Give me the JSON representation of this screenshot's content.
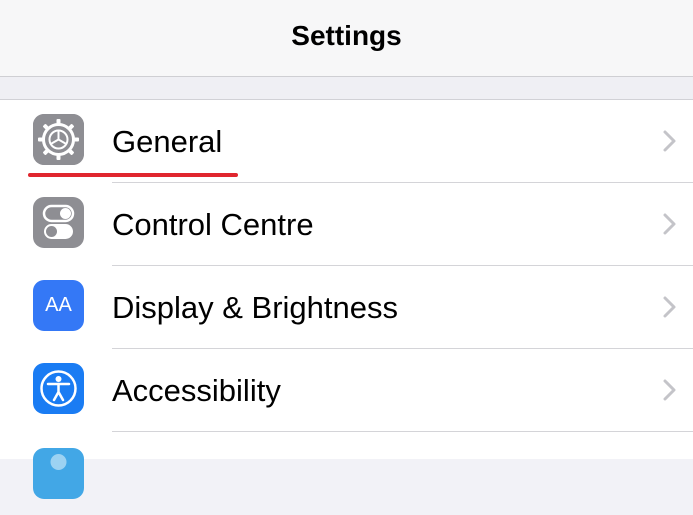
{
  "nav": {
    "title": "Settings"
  },
  "rows": [
    {
      "label": "General",
      "icon": "gear-icon",
      "icon_color": "#8e8e93"
    },
    {
      "label": "Control Centre",
      "icon": "switches-icon",
      "icon_color": "#8e8e93"
    },
    {
      "label": "Display & Brightness",
      "icon": "text-size-icon",
      "icon_color": "#3478f6",
      "icon_text": "AA"
    },
    {
      "label": "Accessibility",
      "icon": "accessibility-icon",
      "icon_color": "#1a7cf3"
    },
    {
      "label": "",
      "icon": "wallpaper-icon",
      "icon_color": "#42a7e6"
    }
  ],
  "annotation": {
    "underline_color": "#e0262e"
  }
}
